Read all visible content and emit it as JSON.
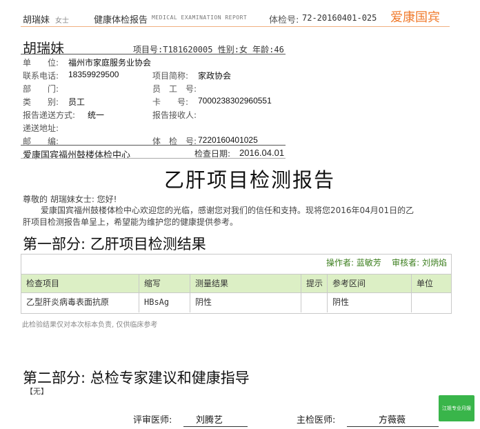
{
  "header": {
    "name": "胡瑞妹",
    "gender": "女士",
    "title": "健康体检报告",
    "subtitle": "MEDICAL EXAMINATION REPORT",
    "exam_label": "体检号:",
    "exam_no": "72-20160401-025",
    "brand": "爱康国宾"
  },
  "patient": {
    "name": "胡瑞妹",
    "summary": "项目号:T181620005 性别:女 年龄:46",
    "unit_label": "单　　位:",
    "unit_value": "福州市家庭服务业协会",
    "phone_label": "联系电话:",
    "phone_value": "18359929500",
    "project_label": "项目简称:",
    "project_value": "家政协会",
    "dept_label": "部　　门:",
    "dept_value": "",
    "staff_label": "员　工　号:",
    "staff_value": "",
    "category_label": "类　　别:",
    "category_value": "员工",
    "card_label": "卡　　号:",
    "card_value": "7000238302960551",
    "delivery_label": "报告递送方式:",
    "delivery_value": "统一",
    "receiver_label": "报告接收人:",
    "receiver_value": "",
    "address_label": "递送地址:",
    "address_value": "",
    "post_label": "邮　　编:",
    "post_value": "",
    "exam_label": "体　检　号:",
    "exam_value": "7220160401025",
    "center": "爱康国宾福州鼓楼体检中心",
    "date_label": "检查日期:",
    "date_value": "2016.04.01"
  },
  "report": {
    "title": "乙肝项目检测报告",
    "greeting": "尊敬的 胡瑞妹女士: 您好!",
    "intro_line1": "爱康国宾福州鼓楼体检中心欢迎您的光临，感谢您对我们的信任和支持。现将您2016年04月01日的乙",
    "intro_line2": "肝项目检测报告单呈上，希望能为维护您的健康提供参考。"
  },
  "part1": {
    "title": "第一部分: 乙肝项目检测结果",
    "operator_label": "操作者:",
    "operator": "蓝敏芳",
    "reviewer_label": "审核者:",
    "reviewer": "刘炳焰",
    "columns": [
      "检查项目",
      "缩写",
      "测量结果",
      "提示",
      "参考区间",
      "单位"
    ],
    "rows": [
      [
        "乙型肝炎病毒表面抗原",
        "HBsAg",
        "阴性",
        "",
        "阴性",
        ""
      ]
    ],
    "disclaimer": "此检验结果仅对本次标本负责, 仅供临床参考"
  },
  "part2": {
    "title": "第二部分: 总检专家建议和健康指导",
    "content": "【无】"
  },
  "signatures": {
    "reviewer_label": "评审医师:",
    "reviewer_name": "刘腾艺",
    "chief_label": "主检医师:",
    "chief_name": "方薇薇"
  },
  "side_badge": "江姐专业月嫂",
  "colors": {
    "brand": "#f07a2c",
    "table_header_bg": "#dcefc5",
    "operator_text": "#3d7f1f",
    "badge": "#39b54a"
  }
}
